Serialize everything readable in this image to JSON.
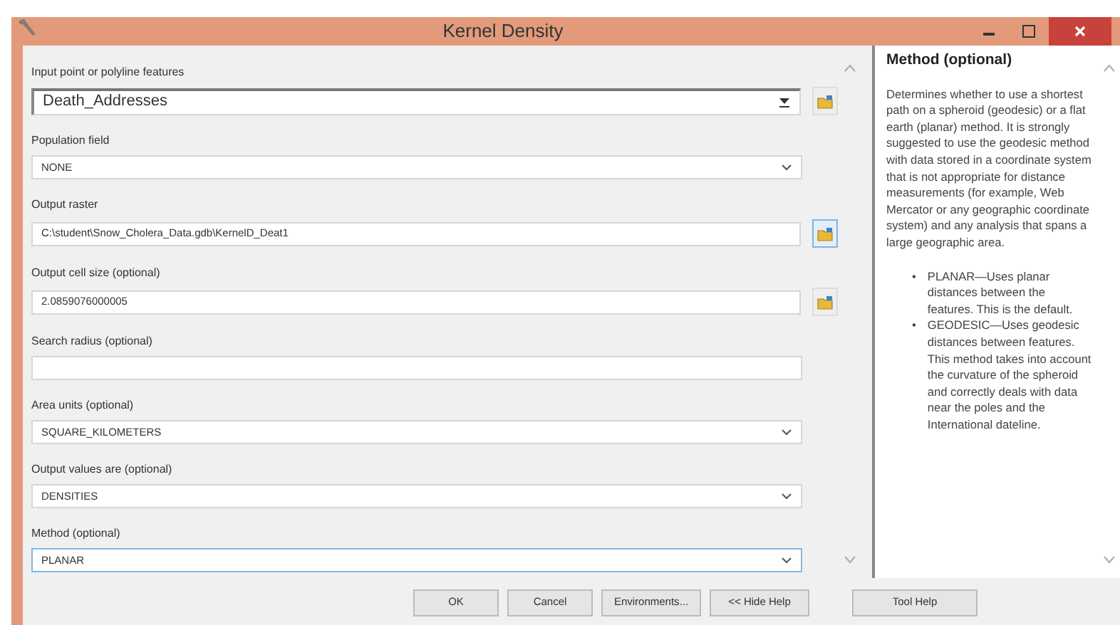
{
  "window": {
    "title": "Kernel Density"
  },
  "fields": [
    {
      "label": "Input point or polyline features",
      "kind": "combo",
      "value": "Death_Addresses",
      "focused": false,
      "browse_highlighted": false
    },
    {
      "label": "Population field",
      "kind": "dropdown",
      "value": "NONE",
      "focused": false
    },
    {
      "label": "Output raster",
      "kind": "browse",
      "value": "C:\\student\\Snow_Cholera_Data.gdb\\KernelD_Deat1",
      "focused": false,
      "browse_highlighted": true
    },
    {
      "label": "Output cell size (optional)",
      "kind": "browse",
      "value": "2.0859076000005",
      "focused": false,
      "browse_highlighted": false
    },
    {
      "label": "Search radius (optional)",
      "kind": "text",
      "focused": false
    },
    {
      "label": "Area units (optional)",
      "kind": "dropdown",
      "value": "SQUARE_KILOMETERS",
      "focused": false
    },
    {
      "label": "Output values are (optional)",
      "kind": "dropdown",
      "value": "DENSITIES",
      "focused": false
    },
    {
      "label": "Method (optional)",
      "kind": "dropdown",
      "value": "PLANAR",
      "focused": true
    }
  ],
  "help": {
    "title": "Method (optional)",
    "paragraph": "Determines whether to use a shortest path on a spheroid (geodesic) or a flat earth (planar) method. It is strongly suggested to use the geodesic method with data stored in a coordinate system that is not appropriate for distance measurements (for example, Web Mercator or any geographic coordinate system) and any analysis that spans a large geographic area.",
    "bullets": [
      {
        "marker": "•",
        "text": "PLANAR—Uses planar distances between the features. This is the default."
      },
      {
        "marker": "•",
        "text": "GEODESIC—Uses geodesic distances between features. This method takes into account the curvature of the spheroid and correctly deals with data near the poles and the International dateline."
      }
    ]
  },
  "buttons": [
    "OK",
    "Cancel",
    "Environments...",
    "<< Hide Help"
  ],
  "help_button": "Tool Help"
}
